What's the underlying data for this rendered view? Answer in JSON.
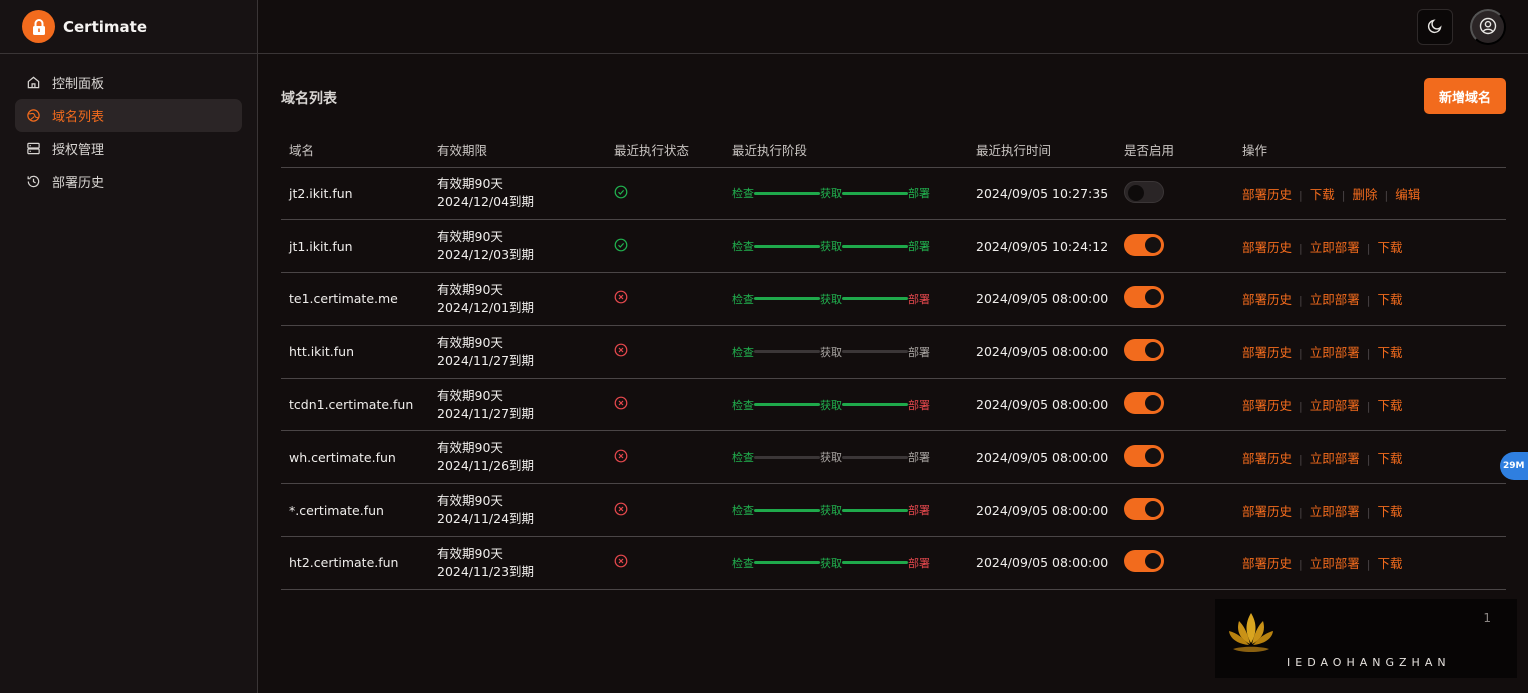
{
  "app": {
    "name": "Certimate"
  },
  "nav": [
    {
      "label": "控制面板",
      "icon": "home-icon",
      "active": false
    },
    {
      "label": "域名列表",
      "icon": "globe-icon",
      "active": true
    },
    {
      "label": "授权管理",
      "icon": "server-icon",
      "active": false
    },
    {
      "label": "部署历史",
      "icon": "history-icon",
      "active": false
    }
  ],
  "page": {
    "title": "域名列表",
    "add_label": "新增域名"
  },
  "table": {
    "columns": [
      "域名",
      "有效期限",
      "最近执行状态",
      "最近执行阶段",
      "最近执行时间",
      "是否启用",
      "操作"
    ],
    "stage_labels": [
      "检查",
      "获取",
      "部署"
    ],
    "rows": [
      {
        "domain": "jt2.ikit.fun",
        "validity": "有效期90天",
        "expire": "2024/12/04到期",
        "status": "success",
        "stage_state": "all",
        "time": "2024/09/05 10:27:35",
        "enabled": false,
        "actions": [
          "部署历史",
          "下载",
          "删除",
          "编辑"
        ]
      },
      {
        "domain": "jt1.ikit.fun",
        "validity": "有效期90天",
        "expire": "2024/12/03到期",
        "status": "success",
        "stage_state": "all",
        "time": "2024/09/05 10:24:12",
        "enabled": true,
        "actions": [
          "部署历史",
          "立即部署",
          "下载"
        ]
      },
      {
        "domain": "te1.certimate.me",
        "validity": "有效期90天",
        "expire": "2024/12/01到期",
        "status": "failed",
        "stage_state": "deploy-failed",
        "time": "2024/09/05 08:00:00",
        "enabled": true,
        "actions": [
          "部署历史",
          "立即部署",
          "下载"
        ]
      },
      {
        "domain": "htt.ikit.fun",
        "validity": "有效期90天",
        "expire": "2024/11/27到期",
        "status": "failed",
        "stage_state": "check-only",
        "time": "2024/09/05 08:00:00",
        "enabled": true,
        "actions": [
          "部署历史",
          "立即部署",
          "下载"
        ]
      },
      {
        "domain": "tcdn1.certimate.fun",
        "validity": "有效期90天",
        "expire": "2024/11/27到期",
        "status": "failed",
        "stage_state": "deploy-failed",
        "time": "2024/09/05 08:00:00",
        "enabled": true,
        "actions": [
          "部署历史",
          "立即部署",
          "下载"
        ]
      },
      {
        "domain": "wh.certimate.fun",
        "validity": "有效期90天",
        "expire": "2024/11/26到期",
        "status": "failed",
        "stage_state": "check-only",
        "time": "2024/09/05 08:00:00",
        "enabled": true,
        "actions": [
          "部署历史",
          "立即部署",
          "下载"
        ]
      },
      {
        "domain": "*.certimate.fun",
        "validity": "有效期90天",
        "expire": "2024/11/24到期",
        "status": "failed",
        "stage_state": "deploy-failed",
        "time": "2024/09/05 08:00:00",
        "enabled": true,
        "actions": [
          "部署历史",
          "立即部署",
          "下载"
        ]
      },
      {
        "domain": "ht2.certimate.fun",
        "validity": "有效期90天",
        "expire": "2024/11/23到期",
        "status": "failed",
        "stage_state": "deploy-failed",
        "time": "2024/09/05 08:00:00",
        "enabled": true,
        "actions": [
          "部署历史",
          "立即部署",
          "下载"
        ]
      }
    ]
  },
  "pagination": {
    "current": "1"
  },
  "memory_badge": "29M",
  "watermark": "IEDAOHANGZHAN",
  "colors": {
    "accent": "#f26b1d",
    "success": "#21b24f",
    "danger": "#e5484d",
    "background": "#120d0d"
  }
}
